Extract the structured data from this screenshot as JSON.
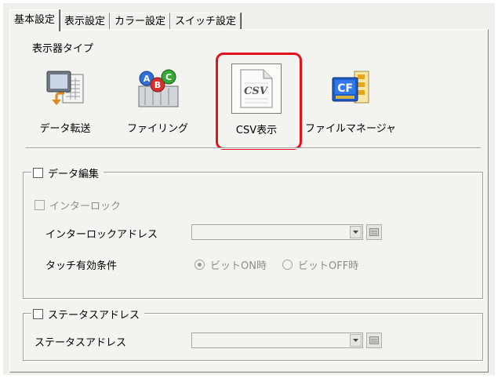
{
  "tabs": [
    "基本設定",
    "表示設定",
    "カラー設定",
    "スイッチ設定"
  ],
  "active_tab": 0,
  "display_type": {
    "title": "表示器タイプ",
    "buttons": [
      {
        "label": "データ転送",
        "icon": "data-transfer-icon"
      },
      {
        "label": "ファイリング",
        "icon": "filing-icon"
      },
      {
        "label": "CSV表示",
        "icon": "csv-file-icon",
        "icon_text": "CSV"
      },
      {
        "label": "ファイルマネージャ",
        "icon": "cf-card-file-manager-icon",
        "icon_text": "CF"
      }
    ],
    "selected": 2
  },
  "data_edit": {
    "title": "データ編集",
    "checked": false,
    "interlock_label": "インターロック",
    "interlock_address_label": "インターロックアドレス",
    "touch_condition_label": "タッチ有効条件",
    "radio_on": "ビットON時",
    "radio_off": "ビットOFF時",
    "selected_condition": "ビットON時"
  },
  "status_address": {
    "title": "ステータスアドレス",
    "checked": false,
    "field_label": "ステータスアドレス"
  },
  "colors": {
    "highlight": "#e0141a"
  }
}
